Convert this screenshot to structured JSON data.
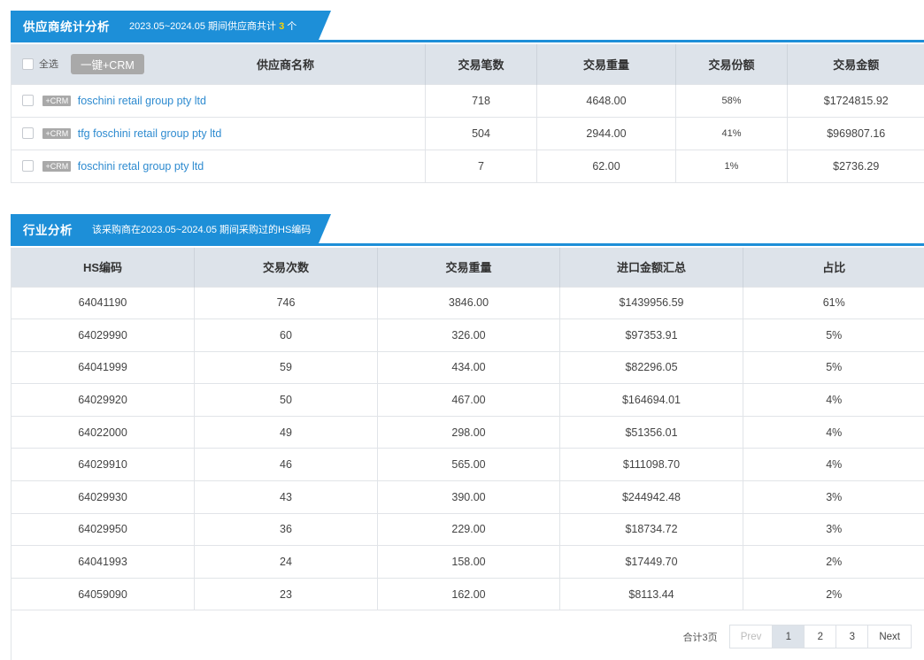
{
  "supplier_section": {
    "title": "供应商统计分析",
    "subtitle_prefix": "2023.05~2024.05 期间供应商共计",
    "count": "3",
    "subtitle_suffix": "个",
    "select_all_label": "全选",
    "bulk_crm_label": "一键+CRM",
    "columns": [
      "供应商名称",
      "交易笔数",
      "交易重量",
      "交易份额",
      "交易金额"
    ],
    "crm_badge": "+CRM",
    "rows": [
      {
        "name": "foschini retail group pty ltd",
        "count": "718",
        "weight": "4648.00",
        "share": "58%",
        "amount": "$1724815.92"
      },
      {
        "name": "tfg foschini retail group pty ltd",
        "count": "504",
        "weight": "2944.00",
        "share": "41%",
        "amount": "$969807.16"
      },
      {
        "name": "foschini retal group pty ltd",
        "count": "7",
        "weight": "62.00",
        "share": "1%",
        "amount": "$2736.29"
      }
    ]
  },
  "industry_section": {
    "title": "行业分析",
    "subtitle": "该采购商在2023.05~2024.05 期间采购过的HS编码",
    "columns": [
      "HS编码",
      "交易次数",
      "交易重量",
      "进口金额汇总",
      "占比"
    ],
    "rows": [
      {
        "hs": "64041190",
        "times": "746",
        "weight": "3846.00",
        "amount": "$1439956.59",
        "ratio": "61%"
      },
      {
        "hs": "64029990",
        "times": "60",
        "weight": "326.00",
        "amount": "$97353.91",
        "ratio": "5%"
      },
      {
        "hs": "64041999",
        "times": "59",
        "weight": "434.00",
        "amount": "$82296.05",
        "ratio": "5%"
      },
      {
        "hs": "64029920",
        "times": "50",
        "weight": "467.00",
        "amount": "$164694.01",
        "ratio": "4%"
      },
      {
        "hs": "64022000",
        "times": "49",
        "weight": "298.00",
        "amount": "$51356.01",
        "ratio": "4%"
      },
      {
        "hs": "64029910",
        "times": "46",
        "weight": "565.00",
        "amount": "$111098.70",
        "ratio": "4%"
      },
      {
        "hs": "64029930",
        "times": "43",
        "weight": "390.00",
        "amount": "$244942.48",
        "ratio": "3%"
      },
      {
        "hs": "64029950",
        "times": "36",
        "weight": "229.00",
        "amount": "$18734.72",
        "ratio": "3%"
      },
      {
        "hs": "64041993",
        "times": "24",
        "weight": "158.00",
        "amount": "$17449.70",
        "ratio": "2%"
      },
      {
        "hs": "64059090",
        "times": "23",
        "weight": "162.00",
        "amount": "$8113.44",
        "ratio": "2%"
      }
    ]
  },
  "pagination": {
    "total_label": "合计3页",
    "prev_label": "Prev",
    "pages": [
      "1",
      "2",
      "3"
    ],
    "active_page": "1",
    "next_label": "Next"
  },
  "colors": {
    "accent": "#1d8fd8",
    "highlight": "#ffd400",
    "link": "#2e8bd0",
    "header_bg": "#dde3ea",
    "badge_bg": "#a9a9a9"
  }
}
